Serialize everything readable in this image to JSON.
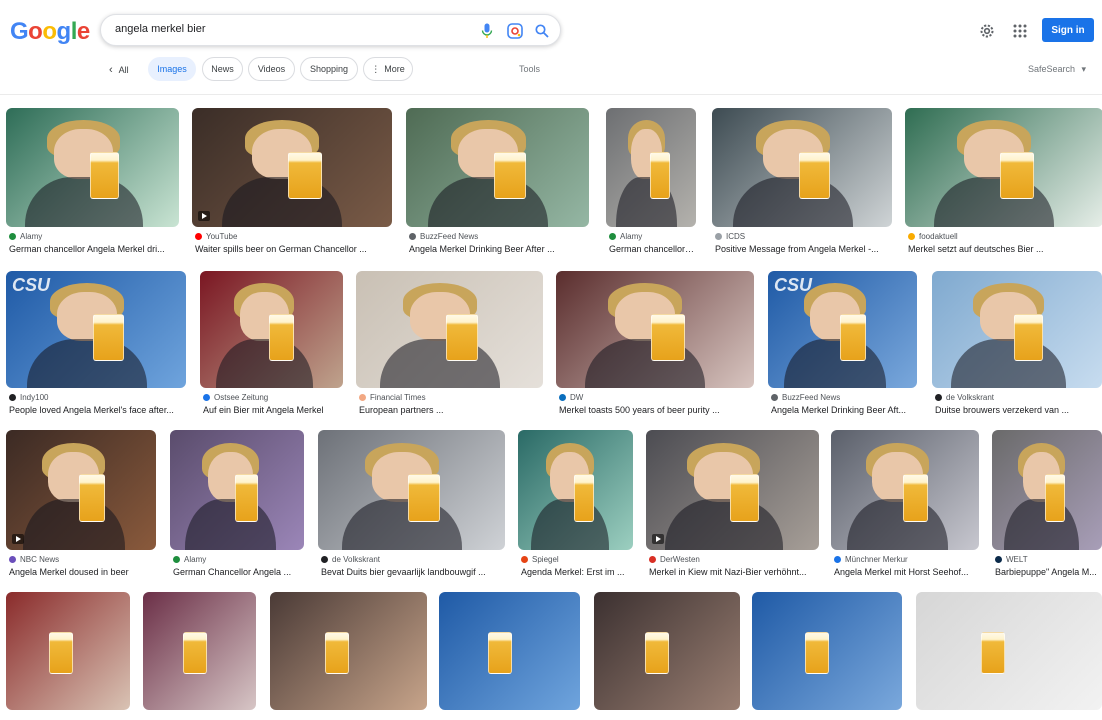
{
  "search": {
    "query": "angela merkel bier"
  },
  "header": {
    "signin_label": "Sign in"
  },
  "tabs": {
    "all": "All",
    "items": [
      "Images",
      "News",
      "Videos",
      "Shopping",
      "More"
    ],
    "tools": "Tools",
    "safesearch": "SafeSearch"
  },
  "colors": {
    "accent": "#1a73e8",
    "beer": "#e7a21b",
    "csu_blue": "#1f5aa6"
  },
  "results": [
    {
      "source": "Alamy",
      "title": "German chancellor Angela Merkel dri...",
      "fav": "#1e8e3e"
    },
    {
      "source": "YouTube",
      "title": "Waiter spills beer on German Chancellor ...",
      "fav": "#ff0000"
    },
    {
      "source": "BuzzFeed News",
      "title": "Angela Merkel Drinking Beer After ...",
      "fav": "#5f6368"
    },
    {
      "source": "Alamy",
      "title": "German chancellor ...",
      "fav": "#1e8e3e"
    },
    {
      "source": "ICDS",
      "title": "Positive Message from Angela Merkel -...",
      "fav": "#9aa0a6"
    },
    {
      "source": "foodaktuell",
      "title": "Merkel setzt auf deutsches Bier ...",
      "fav": "#f9ab00"
    },
    {
      "source": "Indy100",
      "title": "People loved Angela Merkel's face after...",
      "fav": "#202124"
    },
    {
      "source": "Ostsee Zeitung",
      "title": "Auf ein Bier mit Angela Merkel",
      "fav": "#1a73e8"
    },
    {
      "source": "Financial Times",
      "title": "European partners ...",
      "fav": "#f2a883"
    },
    {
      "source": "DW",
      "title": "Merkel toasts 500 years of beer purity ...",
      "fav": "#0a6ebd"
    },
    {
      "source": "BuzzFeed News",
      "title": "Angela Merkel Drinking Beer Aft...",
      "fav": "#5f6368"
    },
    {
      "source": "de Volkskrant",
      "title": "Duitse brouwers verzekerd van ...",
      "fav": "#202124"
    },
    {
      "source": "NBC News",
      "title": "Angela Merkel doused in beer",
      "fav": "#6b4fbb"
    },
    {
      "source": "Alamy",
      "title": "German Chancellor Angela ...",
      "fav": "#1e8e3e"
    },
    {
      "source": "de Volkskrant",
      "title": "Bevat Duits bier gevaarlijk landbouwgif ...",
      "fav": "#202124"
    },
    {
      "source": "Spiegel",
      "title": "Agenda Merkel: Erst im ...",
      "fav": "#e64415"
    },
    {
      "source": "DerWesten",
      "title": "Merkel in Kiew mit Nazi-Bier verhöhnt...",
      "fav": "#d93025"
    },
    {
      "source": "Münchner Merkur",
      "title": "Angela Merkel mit Horst Seehof...",
      "fav": "#1a73e8"
    },
    {
      "source": "WELT",
      "title": "Barbiepuppe\" Angela M...",
      "fav": "#0b2a4a"
    }
  ]
}
